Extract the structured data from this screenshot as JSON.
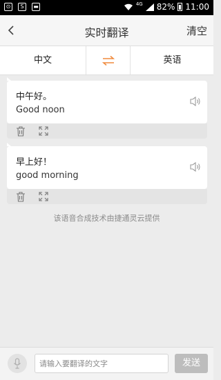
{
  "status_bar": {
    "network": "4G",
    "battery": "82%",
    "time": "11:00"
  },
  "header": {
    "title": "实时翻译",
    "clear_label": "清空"
  },
  "language_bar": {
    "source": "中文",
    "target": "英语"
  },
  "translations": [
    {
      "source": "中午好。",
      "target": "Good noon"
    },
    {
      "source": "早上好！",
      "target": "good morning"
    }
  ],
  "credit": "该语音合成技术由捷通灵云提供",
  "input_bar": {
    "placeholder": "请输入要翻译的文字",
    "send_label": "发送"
  },
  "colors": {
    "accent": "#f08a3c",
    "send_button": "#bdbdbd"
  }
}
